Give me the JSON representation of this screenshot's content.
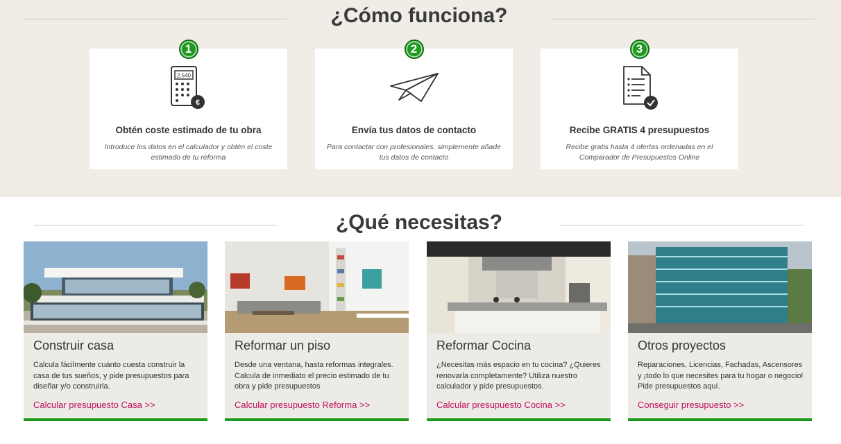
{
  "how_section": {
    "title": "¿Cómo funciona?",
    "steps": [
      {
        "number": "1",
        "icon": "calculator-euro-icon",
        "calc_display": "2.540",
        "title": "Obtén coste estimado de tu obra",
        "description": "Introduce los datos en el calculador y obtén el coste estimado de tu reforma"
      },
      {
        "number": "2",
        "icon": "paper-plane-icon",
        "title": "Envía tus datos de contacto",
        "description": "Para contactar con profesionales, simplemente añade tus datos de contacto"
      },
      {
        "number": "3",
        "icon": "checklist-document-icon",
        "title": "Recibe GRATIS 4 presupuestos",
        "description": "Recibe gratis hasta 4 ofertas ordenadas en el Comparador de Presupuestos Online"
      }
    ]
  },
  "need_section": {
    "title": "¿Qué necesitas?",
    "cards": [
      {
        "image": "modern-house-photo",
        "title": "Construir casa",
        "description": "Calcula fácilmente cuánto cuesta construir la casa de tus sueños, y pide presupuestos para diseñar y/o construirla.",
        "link": "Calcular presupuesto Casa >>"
      },
      {
        "image": "living-room-photo",
        "title": "Reformar un piso",
        "description": "Desde una ventana, hasta reformas integrales. Calcula de inmediato el precio estimado de tu obra y pide presupuestos",
        "link": "Calcular presupuesto Reforma >>"
      },
      {
        "image": "kitchen-photo",
        "title": "Reformar Cocina",
        "description": "¿Necesitas más espacio en tu cocina? ¿Quieres renovarla completamente? Utiliza nuestro calculador y pide presupuestos.",
        "link": "Calcular presupuesto Cocina >>"
      },
      {
        "image": "glass-building-photo",
        "title": "Otros proyectos",
        "description": "Reparaciones, Licencias, Fachadas, Ascensores y ¡todo lo que necesites para tu hogar o negocio! Pide presupuestos aquí.",
        "link": "Conseguir presupuesto >>"
      }
    ]
  },
  "colors": {
    "accent_green": "#1a9a1a",
    "link_magenta": "#c0105e",
    "section_bg": "#efede6",
    "card_bg": "#edebe5"
  }
}
